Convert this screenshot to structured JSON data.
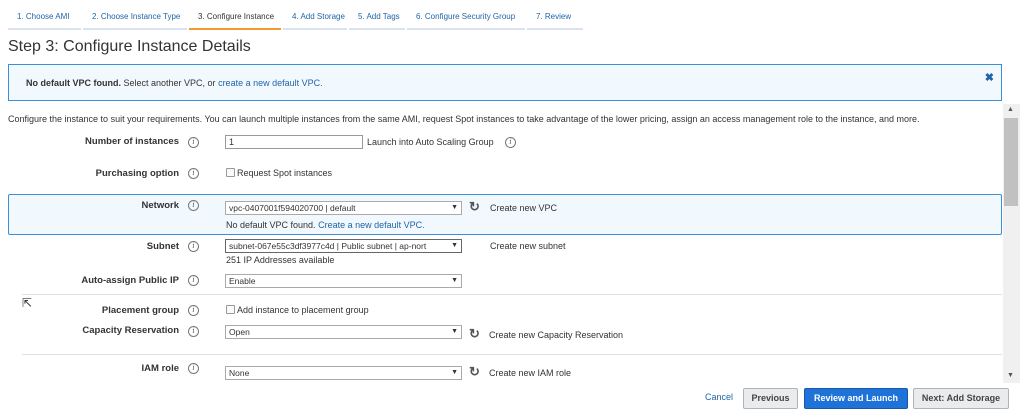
{
  "tabs": [
    {
      "label": "1. Choose AMI"
    },
    {
      "label": "2. Choose Instance Type"
    },
    {
      "label": "3. Configure Instance"
    },
    {
      "label": "4. Add Storage"
    },
    {
      "label": "5. Add Tags"
    },
    {
      "label": "6. Configure Security Group"
    },
    {
      "label": "7. Review"
    }
  ],
  "page_title": "Step 3: Configure Instance Details",
  "alert": {
    "bold": "No default VPC found.",
    "text": " Select another VPC, or ",
    "link": "create a new default VPC.",
    "close": "✖"
  },
  "intro": "Configure the instance to suit your requirements. You can launch multiple instances from the same AMI, request Spot instances to take advantage of the lower pricing, assign an access management role to the instance, and more.",
  "info_glyph": "i",
  "refresh_glyph": "↻",
  "select_arrow": "▼",
  "form": {
    "instances": {
      "label": "Number of instances",
      "value": "1",
      "link": "Launch into Auto Scaling Group"
    },
    "purchasing": {
      "label": "Purchasing option",
      "checkbox": "Request Spot instances"
    },
    "network": {
      "label": "Network",
      "value": "vpc-0407001f594020700 | default",
      "link": "Create new VPC",
      "note": "No default VPC found.",
      "note_link": "Create a new default VPC."
    },
    "subnet": {
      "label": "Subnet",
      "value": "subnet-067e55c3df3977c4d | Public subnet | ap-nort",
      "link": "Create new subnet",
      "note": "251 IP Addresses available"
    },
    "public_ip": {
      "label": "Auto-assign Public IP",
      "value": "Enable"
    },
    "placement": {
      "label": "Placement group",
      "checkbox": "Add instance to placement group"
    },
    "capacity": {
      "label": "Capacity Reservation",
      "value": "Open",
      "link": "Create new Capacity Reservation"
    },
    "iam": {
      "label": "IAM role",
      "value": "None",
      "link": "Create new IAM role"
    }
  },
  "buttons": {
    "cancel": "Cancel",
    "previous": "Previous",
    "review": "Review and Launch",
    "next": "Next: Add Storage"
  },
  "colors": {
    "accent": "#1f73d8",
    "link": "#1f65a8",
    "active_tab": "#f19a2f"
  }
}
